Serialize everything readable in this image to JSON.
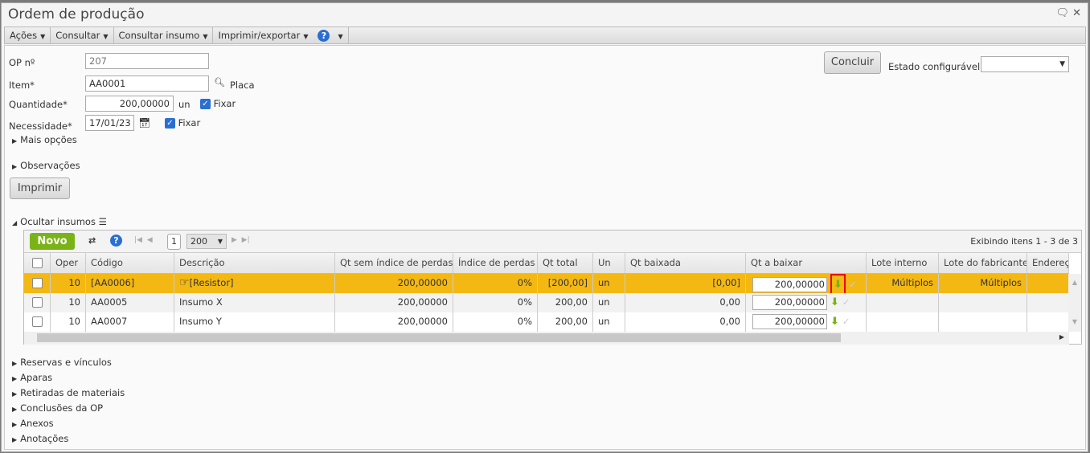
{
  "window": {
    "title": "Ordem de produção"
  },
  "menu": [
    "Ações",
    "Consultar",
    "Consultar insumo",
    "Imprimir/exportar"
  ],
  "form": {
    "op_label": "OP nº",
    "op_value": "207",
    "item_label": "Item*",
    "item_value": "AA0001",
    "item_desc": "Placa",
    "qtd_label": "Quantidade*",
    "qtd_value": "200,00000",
    "qtd_unit": "un",
    "fixar": "Fixar",
    "nec_label": "Necessidade*",
    "nec_value": "17/01/23",
    "fixar2": "Fixar",
    "mais": "Mais opções",
    "obs": "Observações",
    "imprimir": "Imprimir",
    "concluir": "Concluir",
    "estado_label": "Estado configurável",
    "estado_value": ""
  },
  "insumos": {
    "toggle": "Ocultar insumos",
    "novo": "Novo",
    "page": "1",
    "page_size": "200",
    "summary": "Exibindo itens 1 - 3 de 3",
    "columns": [
      "Oper",
      "Código",
      "Descrição",
      "Qt sem índice de perdas",
      "Índice de perdas",
      "Qt total",
      "Un",
      "Qt baixada",
      "Qt a baixar",
      "Lote interno",
      "Lote do fabricante",
      "Endereço"
    ],
    "rows": [
      {
        "oper": "10",
        "codigo": "[AA0006]",
        "descricao": "[Resistor]",
        "qt_sem": "200,00000",
        "indice": "0%",
        "qt_total": "[200,00]",
        "un": "un",
        "qt_baixada": "[0,00]",
        "qt_baixar": "200,00000",
        "lote_interno": "Múltiplos",
        "lote_fab": "Múltiplos"
      },
      {
        "oper": "10",
        "codigo": "AA0005",
        "descricao": "Insumo X",
        "qt_sem": "200,00000",
        "indice": "0%",
        "qt_total": "200,00",
        "un": "un",
        "qt_baixada": "0,00",
        "qt_baixar": "200,00000",
        "lote_interno": "",
        "lote_fab": ""
      },
      {
        "oper": "10",
        "codigo": "AA0007",
        "descricao": "Insumo Y",
        "qt_sem": "200,00000",
        "indice": "0%",
        "qt_total": "200,00",
        "un": "un",
        "qt_baixada": "0,00",
        "qt_baixar": "200,00000",
        "lote_interno": "",
        "lote_fab": ""
      }
    ]
  },
  "sections": [
    "Reservas e vínculos",
    "Aparas",
    "Retiradas de materiais",
    "Conclusões da OP",
    "Anexos",
    "Anotações"
  ]
}
